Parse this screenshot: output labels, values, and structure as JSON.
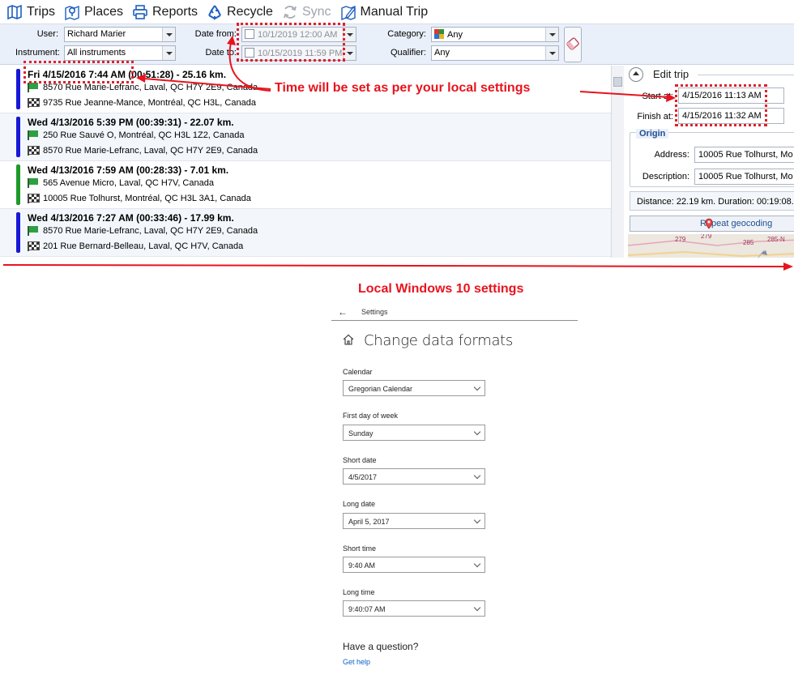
{
  "toolbar": {
    "trips": "Trips",
    "places": "Places",
    "reports": "Reports",
    "recycle": "Recycle",
    "sync": "Sync",
    "manual_trip": "Manual Trip"
  },
  "filters": {
    "user_label": "User:",
    "user_value": "Richard Marier",
    "instrument_label": "Instrument:",
    "instrument_value": "All instruments",
    "date_from_label": "Date from:",
    "date_from_value": "10/1/2019 12:00 AM",
    "date_to_label": "Date to:",
    "date_to_value": "10/15/2019 11:59 PM",
    "category_label": "Category:",
    "category_value": "Any",
    "qualifier_label": "Qualifier:",
    "qualifier_value": "Any"
  },
  "trips": [
    {
      "header": "Fri 4/15/2016 7:44 AM (00:51:28) - 25.16 km.",
      "origin": "8570 Rue Marie-Lefranc, Laval, QC H7Y 2E9, Canada",
      "destination": "9735 Rue Jeanne-Mance, Montréal, QC H3L, Canada",
      "color": "#1818d6"
    },
    {
      "header": "Wed 4/13/2016 5:39 PM (00:39:31) - 22.07 km.",
      "origin": "250 Rue Sauvé O, Montréal, QC H3L 1Z2, Canada",
      "destination": "8570 Rue Marie-Lefranc, Laval, QC H7Y 2E9, Canada",
      "color": "#1818d6"
    },
    {
      "header": "Wed 4/13/2016 7:59 AM (00:28:33) - 7.01 km.",
      "origin": "565 Avenue Micro, Laval, QC H7V, Canada",
      "destination": "10005 Rue Tolhurst, Montréal, QC H3L 3A1, Canada",
      "color": "#1e9a2c"
    },
    {
      "header": "Wed 4/13/2016 7:27 AM (00:33:46) - 17.99 km.",
      "origin": "8570 Rue Marie-Lefranc, Laval, QC H7Y 2E9, Canada",
      "destination": "201 Rue Bernard-Belleau, Laval, QC H7V, Canada",
      "color": "#1818d6"
    }
  ],
  "edit_trip": {
    "title": "Edit trip",
    "start_label": "Start at:",
    "start_value": "4/15/2016 11:13 AM",
    "finish_label": "Finish at:",
    "finish_value": "4/15/2016 11:32 AM",
    "origin_group": "Origin",
    "address_label": "Address:",
    "address_value": "10005 Rue Tolhurst, Mo",
    "description_label": "Description:",
    "description_value": "10005 Rue Tolhurst, Mo",
    "distance_text": "Distance: 22.19 km. Duration: 00:19:08. A",
    "repeat_geocoding": "Repeat geocoding",
    "map_labels": [
      "279",
      "279",
      "285",
      "285-N"
    ]
  },
  "annotations": {
    "time_callout": "Time will be set as per your local settings",
    "settings_callout": "Local Windows 10 settings",
    "color": "#e8131d"
  },
  "windows_settings": {
    "app_title": "Settings",
    "heading": "Change data formats",
    "fields": [
      {
        "label": "Calendar",
        "value": "Gregorian Calendar"
      },
      {
        "label": "First day of week",
        "value": "Sunday"
      },
      {
        "label": "Short date",
        "value": "4/5/2017"
      },
      {
        "label": "Long date",
        "value": "April 5, 2017"
      },
      {
        "label": "Short time",
        "value": "9:40 AM"
      },
      {
        "label": "Long time",
        "value": "9:40:07 AM"
      }
    ],
    "question": "Have a question?",
    "get_help": "Get help"
  }
}
